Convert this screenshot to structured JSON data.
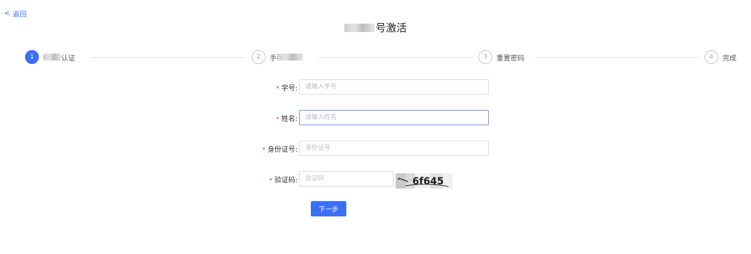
{
  "header": {
    "back_label": "返回",
    "title_suffix": "号激活"
  },
  "steps": [
    {
      "number": "1",
      "label": "认证",
      "active": true
    },
    {
      "number": "2",
      "label": "手",
      "active": false
    },
    {
      "number": "3",
      "label": "重置密码",
      "active": false
    },
    {
      "number": "4",
      "label": "完成",
      "active": false
    }
  ],
  "form": {
    "student_id": {
      "label": "学号:",
      "placeholder": "请输入学号",
      "value": ""
    },
    "name": {
      "label": "姓名:",
      "placeholder": "请输入姓名",
      "value": ""
    },
    "id_card": {
      "label": "身份证号:",
      "placeholder": "身份证号",
      "value": ""
    },
    "captcha": {
      "label": "验证码:",
      "placeholder": "验证码",
      "value": "",
      "image_text": "6f645"
    },
    "required_mark": "*"
  },
  "actions": {
    "next_label": "下一步"
  },
  "colors": {
    "accent": "#3b6ff5",
    "required": "#e53935"
  }
}
